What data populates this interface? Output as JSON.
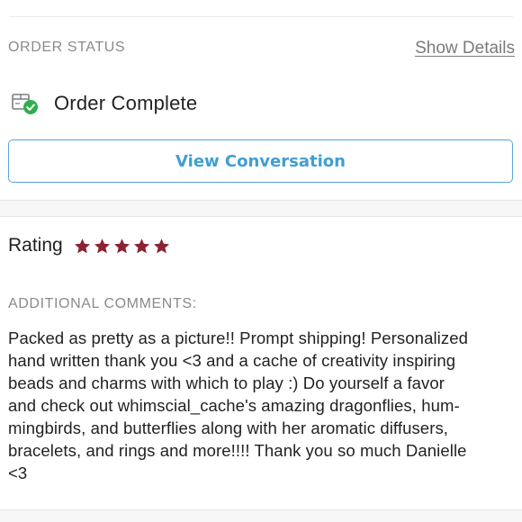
{
  "order": {
    "section_label": "ORDER STATUS",
    "show_details_label": "Show Details",
    "status_text": "Order Complete",
    "status_icon": "package-check-icon",
    "view_conversation_label": "View Conversation"
  },
  "rating": {
    "label": "Rating",
    "stars": 5,
    "max_stars": 5,
    "star_color": "#8b2332"
  },
  "comments": {
    "label": "ADDITIONAL COMMENTS:",
    "lines": [
      "Packed as pretty as a picture!! Prompt shipping! Personalized",
      "hand written thank you <3 and a cache of creativity inspiring",
      "beads and charms with which to play :) Do yourself a favor",
      "and check out whimscial_cache's amazing dragonflies, hum-",
      "mingbirds, and butterflies along with her aromatic diffusers,",
      "bracelets, and rings and more!!!! Thank you so much Danielle",
      "<3"
    ]
  },
  "colors": {
    "accent_blue": "#3f9fd4",
    "success_green": "#2fae4e",
    "star_maroon": "#8b2332"
  }
}
